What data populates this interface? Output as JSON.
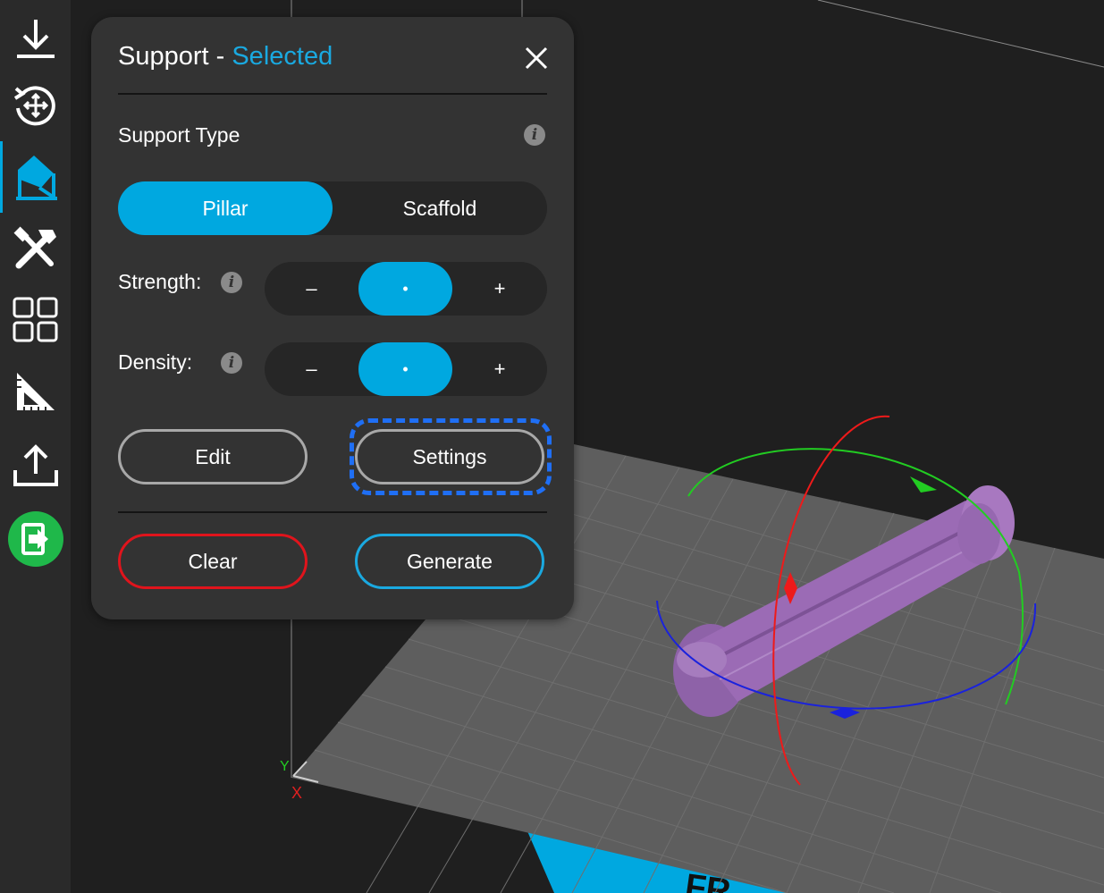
{
  "sidebar": {
    "items": [
      {
        "icon": "download-icon",
        "name": "import"
      },
      {
        "icon": "rotate-move-icon",
        "name": "transform"
      },
      {
        "icon": "support-icon",
        "name": "support",
        "active": true
      },
      {
        "icon": "tools-icon",
        "name": "tools"
      },
      {
        "icon": "grid-icon",
        "name": "arrange"
      },
      {
        "icon": "measure-icon",
        "name": "measure"
      },
      {
        "icon": "upload-icon",
        "name": "export"
      },
      {
        "icon": "exit-icon",
        "name": "exit"
      }
    ]
  },
  "panel": {
    "title": "Support - ",
    "title_status": "Selected",
    "support_type_label": "Support Type",
    "support_type": {
      "options": [
        "Pillar",
        "Scaffold"
      ],
      "selected": "Pillar"
    },
    "strength": {
      "label": "Strength:",
      "minus": "–",
      "value": "•",
      "plus": "+"
    },
    "density": {
      "label": "Density:",
      "minus": "–",
      "value": "•",
      "plus": "+"
    },
    "edit_label": "Edit",
    "settings_label": "Settings",
    "clear_label": "Clear",
    "generate_label": "Generate"
  },
  "scene": {
    "axis_y": "Y",
    "axis_x": "X",
    "plate_text": "FR"
  },
  "colors": {
    "accent": "#00a8e0",
    "clear_border": "#e0141c",
    "focus_ring": "#1f6ff5",
    "model": "#9b6bb5",
    "plate": "#5e5e5e",
    "exit_green": "#1fb84a"
  }
}
